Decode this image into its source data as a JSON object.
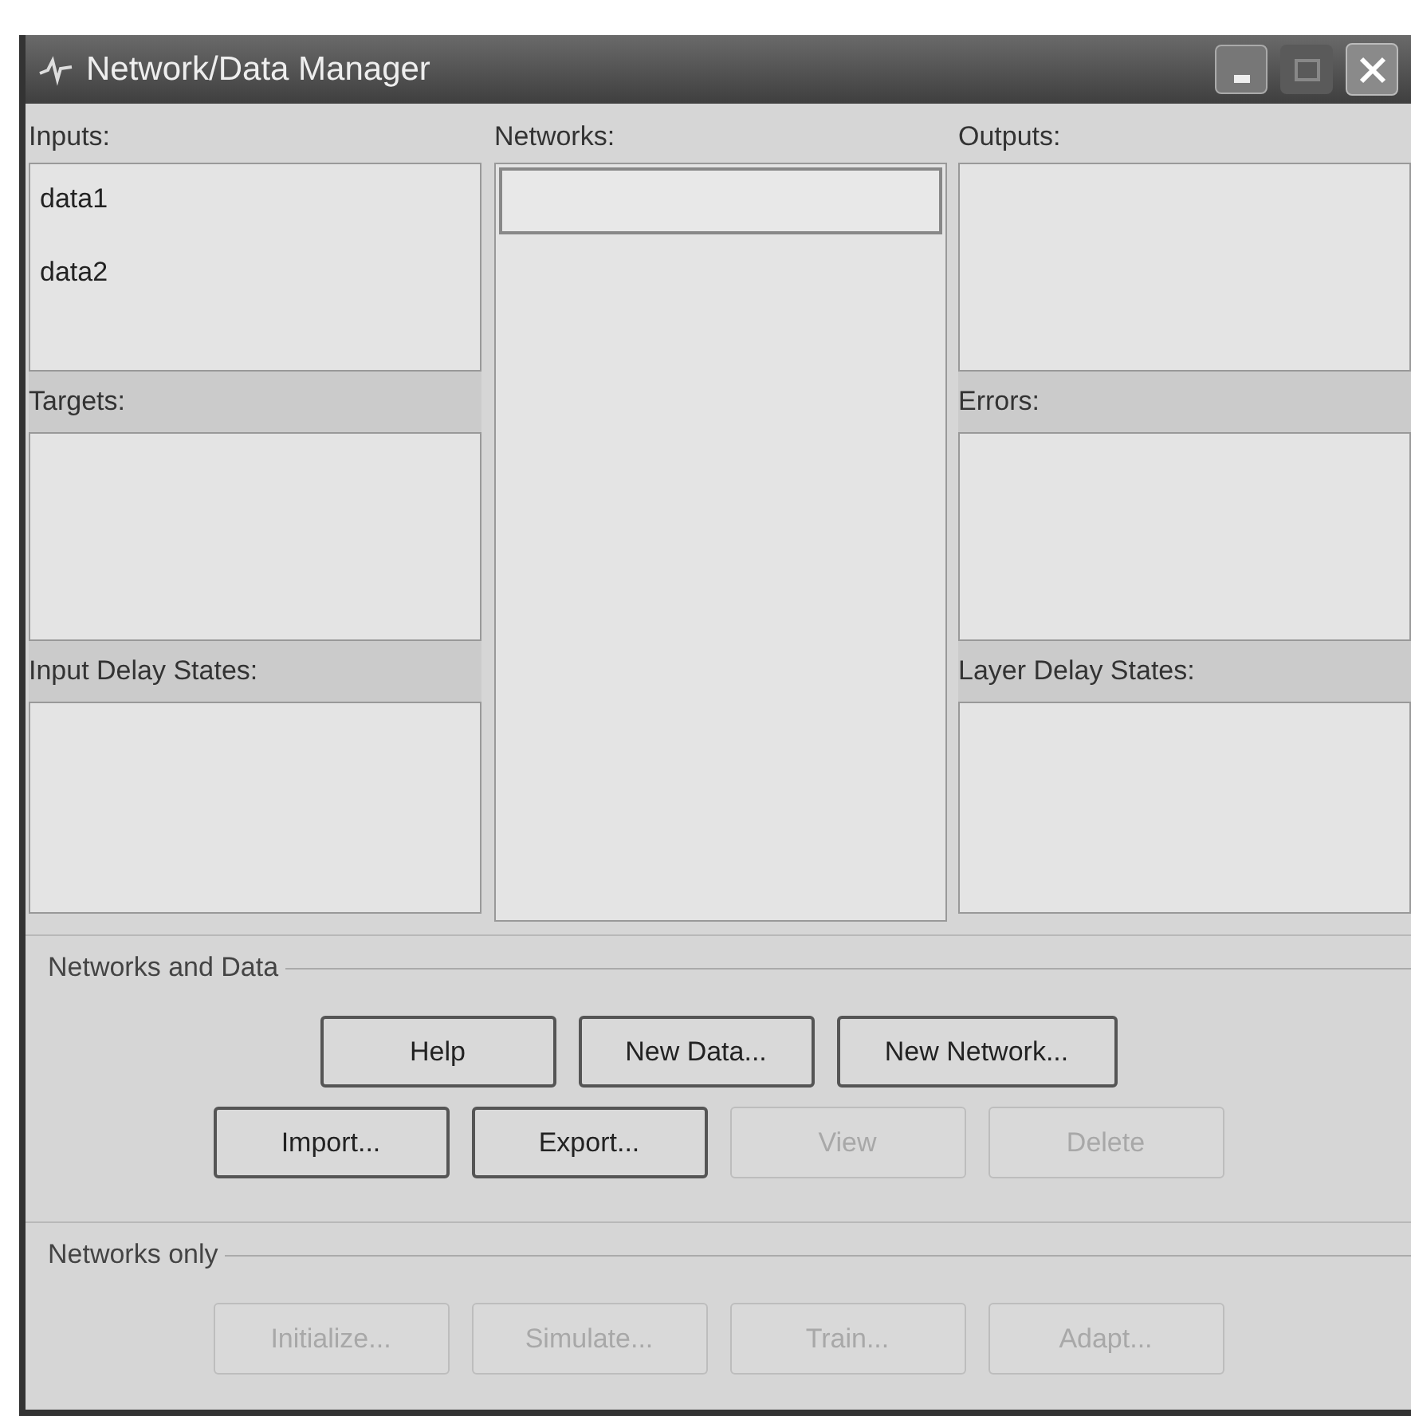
{
  "window": {
    "title": "Network/Data Manager"
  },
  "left": [
    {
      "label": "Inputs:",
      "items": [
        "data1",
        "data2"
      ]
    },
    {
      "label": "Targets:"
    },
    {
      "label": "Input Delay States:"
    }
  ],
  "networks": {
    "label": "Networks:",
    "focused": true
  },
  "right": [
    {
      "label": "Outputs:"
    },
    {
      "label": "Errors:"
    },
    {
      "label": "Layer Delay States:"
    }
  ],
  "groups": [
    {
      "title": "Networks and Data",
      "rows": [
        [
          {
            "label": "Help",
            "disabled": false
          },
          {
            "label": "New Data...",
            "disabled": false
          },
          {
            "label": "New Network...",
            "disabled": false
          }
        ],
        [
          {
            "label": "Import...",
            "disabled": false
          },
          {
            "label": "Export...",
            "disabled": false
          },
          {
            "label": "View",
            "disabled": true
          },
          {
            "label": "Delete",
            "disabled": true
          }
        ]
      ]
    },
    {
      "title": "Networks only",
      "rows": [
        [
          {
            "label": "Initialize...",
            "disabled": true
          },
          {
            "label": "Simulate...",
            "disabled": true
          },
          {
            "label": "Train...",
            "disabled": true
          },
          {
            "label": "Adapt...",
            "disabled": true
          }
        ]
      ]
    }
  ]
}
